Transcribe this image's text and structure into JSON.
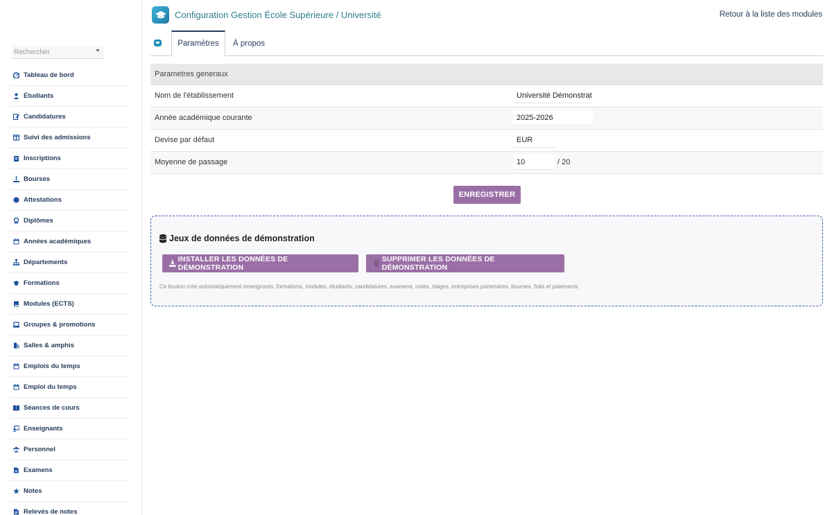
{
  "header": {
    "title": "Configuration Gestion École Supérieure / Université",
    "back_link": "Retour à la liste des modules"
  },
  "sidebar": {
    "search_placeholder": "Rechercher",
    "items": [
      {
        "label": "Tableau de bord",
        "icon": "dashboard-icon"
      },
      {
        "label": "Étudiants",
        "icon": "student-icon"
      },
      {
        "label": "Candidatures",
        "icon": "application-icon"
      },
      {
        "label": "Suivi des admissions",
        "icon": "columns-icon"
      },
      {
        "label": "Inscriptions",
        "icon": "clipboard-icon"
      },
      {
        "label": "Bourses",
        "icon": "scholarship-icon"
      },
      {
        "label": "Attestations",
        "icon": "certificate-icon"
      },
      {
        "label": "Diplômes",
        "icon": "award-icon"
      },
      {
        "label": "Années académiques",
        "icon": "calendar-icon"
      },
      {
        "label": "Départements",
        "icon": "sitemap-icon"
      },
      {
        "label": "Formations",
        "icon": "graduation-cap-icon"
      },
      {
        "label": "Modules (ECTS)",
        "icon": "book-icon"
      },
      {
        "label": "Groupes & promotions",
        "icon": "laptop-icon"
      },
      {
        "label": "Salles & amphis",
        "icon": "door-icon"
      },
      {
        "label": "Emplois du temps",
        "icon": "calendar-icon"
      },
      {
        "label": "Emploi du temps",
        "icon": "calendar-icon"
      },
      {
        "label": "Séances de cours",
        "icon": "open-book-icon"
      },
      {
        "label": "Enseignants",
        "icon": "teacher-icon"
      },
      {
        "label": "Personnel",
        "icon": "users-icon"
      },
      {
        "label": "Examens",
        "icon": "file-icon"
      },
      {
        "label": "Notes",
        "icon": "star-icon"
      },
      {
        "label": "Relevés de notes",
        "icon": "file-text-icon"
      }
    ]
  },
  "tabs": {
    "active": "Paramètres",
    "other": "À propos"
  },
  "settings": {
    "section_title": "Parametres generaux",
    "rows": [
      {
        "label": "Nom de l'établissement",
        "value": "Université Démonstratic"
      },
      {
        "label": "Année académique courante",
        "value": "2025-2026"
      },
      {
        "label": "Devise par défaut",
        "value": "EUR"
      },
      {
        "label": "Moyenne de passage",
        "value": "10",
        "suffix": "/ 20"
      }
    ],
    "save_label": "ENREGISTRER"
  },
  "demo": {
    "title": "Jeux de données de démonstration",
    "install_label": "INSTALLER LES DONNÉES DE DÉMONSTRATION",
    "delete_label": "SUPPRIMER LES DONNÉES DE DÉMONSTRATION",
    "note": "Ce bouton crée automatiquement enseignants, formations, modules, étudiants, candidatures, examens, notes, stages, entreprises partenaires, bourses, frais et paiements."
  },
  "colors": {
    "accent": "#9a6fa6",
    "nav_text": "#263c5a",
    "title": "#2e7d8c",
    "icon": "#1c4f9c"
  }
}
